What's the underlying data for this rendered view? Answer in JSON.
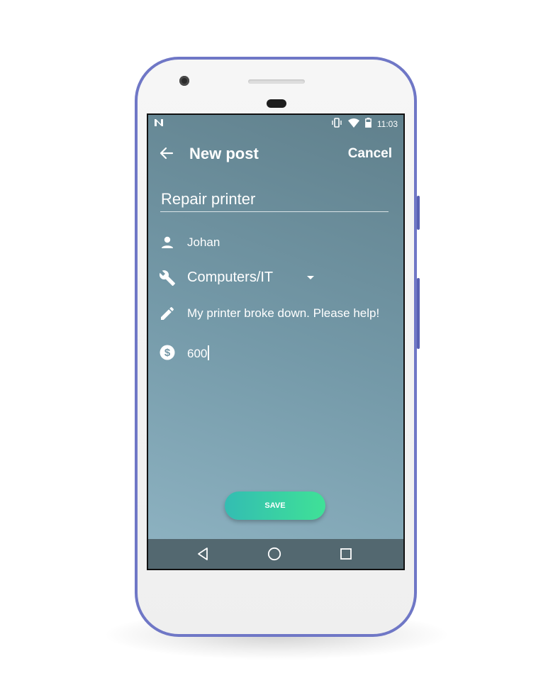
{
  "status_bar": {
    "left_icon": "n-notification-icon",
    "time": "11:03",
    "icons": [
      "vibrate-icon",
      "wifi-icon",
      "battery-icon"
    ]
  },
  "toolbar": {
    "back_icon": "arrow-back-icon",
    "title": "New post",
    "cancel_label": "Cancel"
  },
  "form": {
    "title_value": "Repair printer",
    "author": {
      "icon": "person-icon",
      "value": "Johan"
    },
    "category": {
      "icon": "wrench-icon",
      "value": "Computers/IT"
    },
    "description": {
      "icon": "pencil-icon",
      "value": "My printer broke down. Please help!"
    },
    "price": {
      "icon": "dollar-icon",
      "value": "600"
    }
  },
  "save_label": "SAVE",
  "nav_bar": {
    "icons": [
      "back-triangle-icon",
      "home-circle-icon",
      "recents-square-icon"
    ]
  },
  "colors": {
    "phone_frame": "#6f77c6",
    "screen_top": "#60808c",
    "screen_bottom": "#8fb4c3",
    "save_gradient_start": "#33bdb2",
    "save_gradient_end": "#3fe197",
    "nav_bar": "#536870"
  }
}
